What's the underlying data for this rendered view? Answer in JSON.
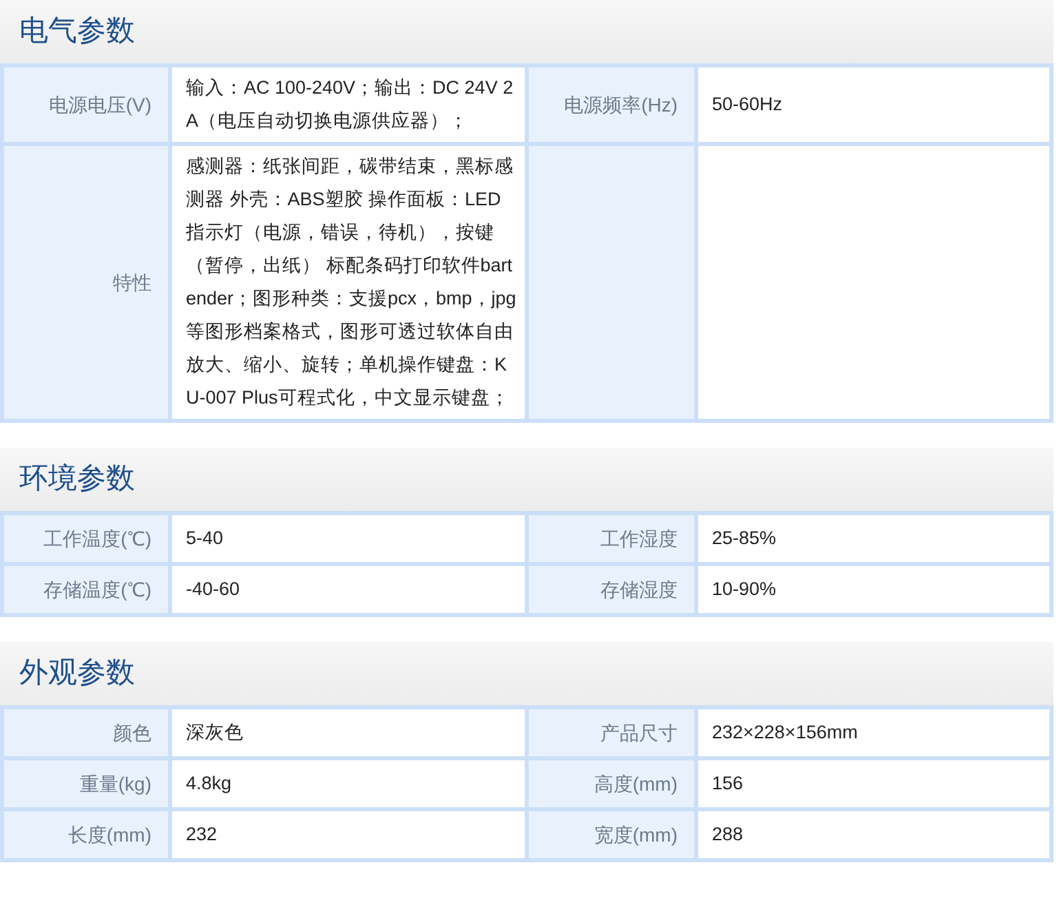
{
  "sections": [
    {
      "title": "电气参数",
      "rows": [
        {
          "pairs": [
            {
              "label": "电源电压(V)",
              "value": "输入：AC 100-240V；输出：DC 24V 2A（电压自动切换电源供应器）；"
            },
            {
              "label": "电源频率(Hz)",
              "value": "50-60Hz"
            }
          ]
        },
        {
          "pairs": [
            {
              "label": "特性",
              "value": "感测器：纸张间距，碳带结束，黑标感测器 外壳：ABS塑胶 操作面板：LED指示灯（电源，错误，待机），按键（暂停，出纸） 标配条码打印软件bartender；图形种类：支援pcx，bmp，jpg等图形档案格式，图形可透过软体自由放大、缩小、旋转；单机操作键盘：KU-007 Plus可程式化，中文显示键盘；"
            }
          ]
        }
      ]
    },
    {
      "title": "环境参数",
      "rows": [
        {
          "pairs": [
            {
              "label": "工作温度(℃)",
              "value": "5-40"
            },
            {
              "label": "工作湿度",
              "value": "25-85%"
            }
          ]
        },
        {
          "pairs": [
            {
              "label": "存储温度(℃)",
              "value": "-40-60"
            },
            {
              "label": "存储湿度",
              "value": "10-90%"
            }
          ]
        }
      ]
    },
    {
      "title": "外观参数",
      "rows": [
        {
          "pairs": [
            {
              "label": "颜色",
              "value": "深灰色"
            },
            {
              "label": "产品尺寸",
              "value": "232×228×156mm"
            }
          ]
        },
        {
          "pairs": [
            {
              "label": "重量(kg)",
              "value": "4.8kg"
            },
            {
              "label": "高度(mm)",
              "value": "156"
            }
          ]
        },
        {
          "pairs": [
            {
              "label": "长度(mm)",
              "value": "232"
            },
            {
              "label": "宽度(mm)",
              "value": "288"
            }
          ]
        }
      ]
    }
  ]
}
